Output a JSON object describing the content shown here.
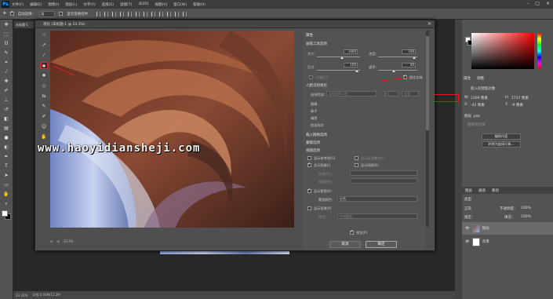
{
  "app": {
    "logo": "Ps"
  },
  "menu": [
    "文件(F)",
    "编辑(E)",
    "图像(I)",
    "图层(L)",
    "文字(Y)",
    "选择(S)",
    "滤镜(T)",
    "3D(D)",
    "视图(V)",
    "窗口(W)",
    "帮助(H)"
  ],
  "options": {
    "auto_select_label": "自动选择：",
    "auto_select_value": "组",
    "transform_label": "显示变换控件"
  },
  "document_tab": "未标题-1",
  "dialog": {
    "title": "液化 (未标题-1 @ 33.3%)",
    "zoom": "33.3%",
    "props_title": "属性",
    "brush_section": "画笔工具选项",
    "size_label": "大小：",
    "size_value": "1400",
    "density_label": "浓度：",
    "density_value": "100",
    "pressure_label": "压力：",
    "pressure_value": "100",
    "rate_label": "速率：",
    "rate_value": "40",
    "stylus_label": "光笔压力",
    "pin_edges_label": "固定边缘",
    "face_section": "人脸识别液化",
    "select_face_label": "选择脸部：",
    "select_face_value": "未检测到人脸",
    "reset_label": "复位",
    "all_label": "全部",
    "face_items": [
      "眼睛",
      "鼻子",
      "嘴唇",
      "脸部形状"
    ],
    "load_mesh": "载入网格选项",
    "mask_options": "蒙版选项",
    "view_options": "视图选项",
    "show_guides": "显示参考线(G)",
    "show_face_overlay": "显示面部叠加(F)",
    "show_image": "显示图像(I)",
    "show_mesh": "显示网格(E)",
    "mesh_size": "网格大小：",
    "mesh_color": "网格颜色：",
    "show_mask": "显示蒙版(K)",
    "mask_color_label": "蒙版颜色：",
    "mask_color_value": "红色",
    "show_backdrop": "显示背景(P)",
    "use_label": "使用：",
    "use_value": "所有图层",
    "preview_label": "预览(P)",
    "cancel": "取消",
    "ok": "确定"
  },
  "watermark": "www.haoyidiansheji.com",
  "status": {
    "zoom": "33.33%",
    "doc": "文档:5.93M/11.2M"
  },
  "right_panel": {
    "props_tabs": [
      "属性",
      "调整"
    ],
    "smart_obj": "嵌入的智能对象",
    "w_label": "W:",
    "w_value": "2309 像素",
    "h_label": "H:",
    "h_value": "1737 像素",
    "x_label": "X:",
    "x_value": "-42 像素",
    "y_label": "Y:",
    "y_value": "-9 像素",
    "file_name": "图层 .psb",
    "file_type": "链接到外部",
    "edit_contents": "编辑内容",
    "convert_linked": "转换为链接对象...",
    "layers_tabs": [
      "图层",
      "通道",
      "路径"
    ],
    "kind_label": "类型",
    "mode_label": "正常",
    "opacity_label": "不透明度：",
    "opacity_value": "100%",
    "lock_label": "锁定：",
    "fill_label": "填充：",
    "fill_value": "100%",
    "layers": [
      {
        "name": "图层"
      },
      {
        "name": "背景"
      }
    ]
  },
  "colors": {
    "accent_red": "#e01b1b",
    "panel": "#535353",
    "dark": "#282828"
  }
}
